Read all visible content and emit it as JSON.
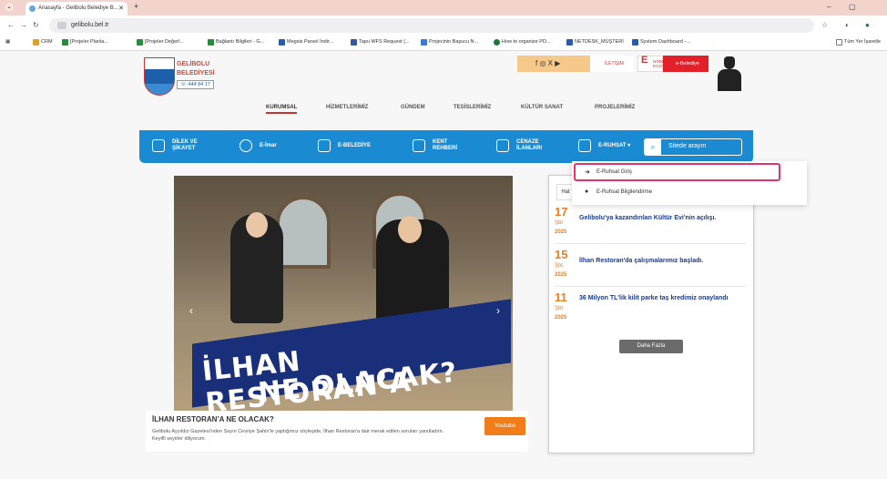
{
  "browser": {
    "tab_title": "Anasayfa - Gelibolu Belediye B...",
    "url": "gelibolu.bel.tr",
    "bookmarks": [
      "CRM",
      "[Projeler Planla...",
      "[Projeler Değerl...",
      "Bağlantı Bilgileri - G...",
      "Megsis Parsel İndir...",
      "Tapu WFS Request (...",
      "Projecinin Başucu N...",
      "How to organize PD...",
      "NETDESK_MÜŞTERİ",
      "System Dashboard -..."
    ],
    "bookmarks_right": "Tüm Yer İşaretle"
  },
  "header": {
    "logo_line1": "GELİBOLU",
    "logo_line2": "BELEDİYESİ",
    "phone": "444 84 17",
    "social": "f ◎ X ▶",
    "iletisim": "İLETİŞİM",
    "nobetci": "NÖBETÇİ ECZANE",
    "ebelediye": "e-Belediye"
  },
  "main_nav": [
    "KURUMSAL",
    "HİZMETLERİMİZ",
    "GÜNDEM",
    "TESİSLERİMİZ",
    "KÜLTÜR SANAT",
    "PROJELERİMİZ"
  ],
  "bluebar": [
    {
      "label": "DİLEK VE\nŞİKAYET",
      "icon": "chat-icon"
    },
    {
      "label": "E-İmar",
      "icon": "location-icon"
    },
    {
      "label": "E-BELEDİYE",
      "icon": "document-icon"
    },
    {
      "label": "KENT\nREHBERİ",
      "icon": "map-icon"
    },
    {
      "label": "CENAZE\nİLANLARI",
      "icon": "building-icon"
    },
    {
      "label": "E-RUHSAT ▾",
      "icon": "permit-icon"
    }
  ],
  "search": {
    "placeholder": "Sitede arayın"
  },
  "dropdown": {
    "items": [
      {
        "label": "E-Ruhsat Giriş",
        "icon": "login-icon"
      },
      {
        "label": "E-Ruhsat Bilgilendirme",
        "icon": "info-icon"
      }
    ]
  },
  "hero": {
    "banner_line1": "İLHAN RESTORAN’A",
    "banner_line2": "NE OLACAK?",
    "caption_title": "İLHAN RESTORAN’A NE OLACAK?",
    "caption_desc": "Gelibolu Ayyıldız Gazetesi'nden Sayın Cevriye Şahin'le yaptığımız söyleşide, İlhan Restoran'a dair merak edilen soruları yanıtladım. Keyifli seyirler diliyorum.",
    "youtube_label": "Youtube"
  },
  "news": {
    "tab": "Hat",
    "items": [
      {
        "day": "17",
        "month": "Şbt",
        "year": "2025",
        "title": "Gelibolu'ya kazandırılan Kültür Evi'nin açılışı."
      },
      {
        "day": "15",
        "month": "Şbt",
        "year": "2025",
        "title": "İlhan Restoran'da çalışmalarımız başladı."
      },
      {
        "day": "11",
        "month": "Şbt",
        "year": "2025",
        "title": "36 Milyon TL'lik kilit parke taş kredimiz onaylandı"
      }
    ],
    "more_label": "Daha Fazla"
  }
}
